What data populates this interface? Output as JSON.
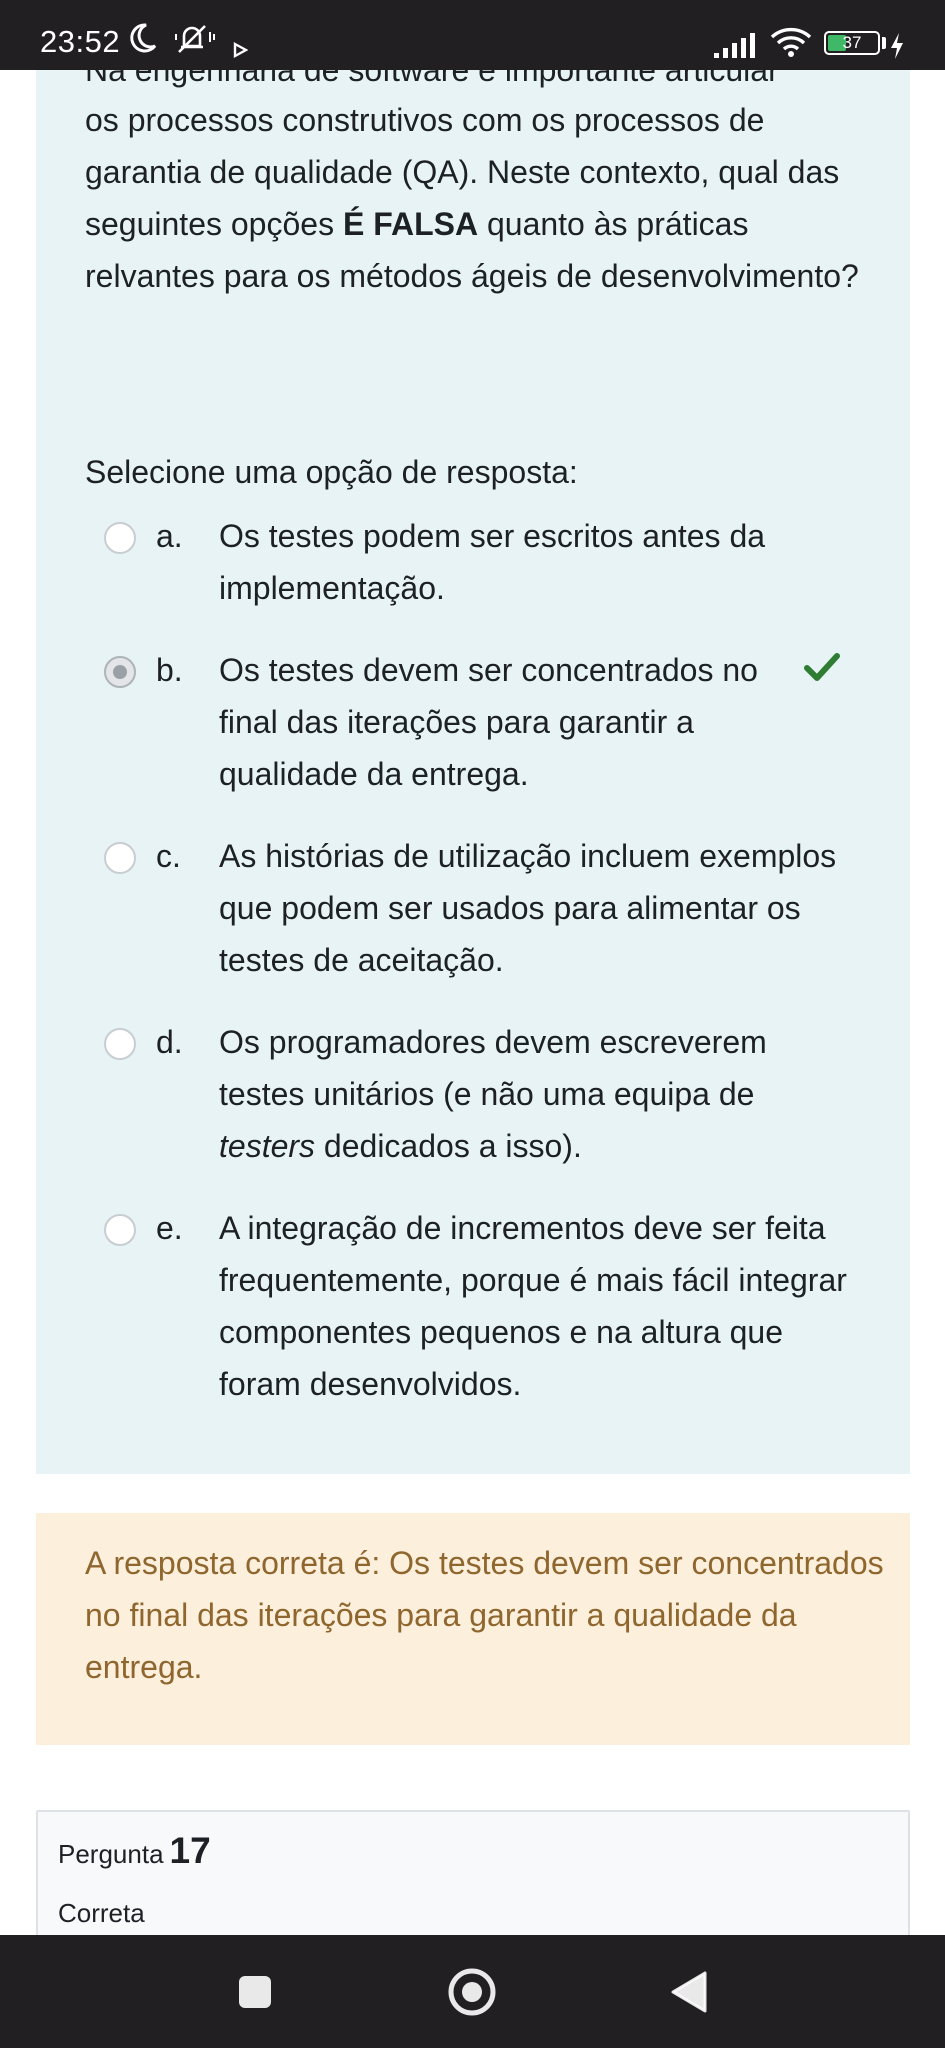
{
  "status_bar": {
    "time": "23:52",
    "battery_level": "37",
    "battery_fraction": 0.37,
    "icons": [
      "moon-icon",
      "bell-off-icon",
      "play-icon",
      "signal-icon",
      "wifi-icon",
      "battery-icon",
      "charging-bolt-icon"
    ]
  },
  "question": {
    "partial_top_line": "Na engenharia de software é importante articular",
    "text_before_bold": "os processos construtivos com os processos de garantia de qualidade (QA). Neste contexto, qual das seguintes opções ",
    "text_bold": "É FALSA",
    "text_after_bold": " quanto às práticas relvantes para os métodos ágeis de desenvolvimento?",
    "prompt": "Selecione uma opção de resposta:",
    "options": [
      {
        "letter": "a.",
        "text": "Os testes podem ser escritos antes da implementação.",
        "selected": false,
        "correct": false
      },
      {
        "letter": "b.",
        "text": "Os testes devem ser concentrados no final das iterações para garantir a qualidade da entrega.",
        "selected": true,
        "correct": true
      },
      {
        "letter": "c.",
        "text": "As histórias de utilização incluem exemplos que podem ser usados para alimentar os testes de aceitação.",
        "selected": false,
        "correct": false
      },
      {
        "letter": "d.",
        "text_part1": "Os programadores devem escreverem testes unitários (e não uma equipa de ",
        "text_italic": "testers",
        "text_part2": " dedicados a isso).",
        "selected": false,
        "correct": false
      },
      {
        "letter": "e.",
        "text": "A integração de incrementos deve ser feita frequentemente, porque é mais fácil integrar componentes pequenos e na altura que foram desenvolvidos.",
        "selected": false,
        "correct": false
      }
    ]
  },
  "feedback": {
    "text": "A resposta correta é: Os testes devem ser concentrados no final das iterações para garantir a qualidade da entrega."
  },
  "next_question": {
    "label": "Pergunta",
    "number": "17",
    "state": "Correta"
  },
  "colors": {
    "question_bg": "#e7f3f5",
    "feedback_bg": "#fcefdc",
    "feedback_text": "#8e662e",
    "correct_check": "#2f7d32",
    "system_bars": "#221f22"
  },
  "nav_bar": {
    "buttons": [
      "recents-icon",
      "home-icon",
      "back-icon"
    ]
  }
}
